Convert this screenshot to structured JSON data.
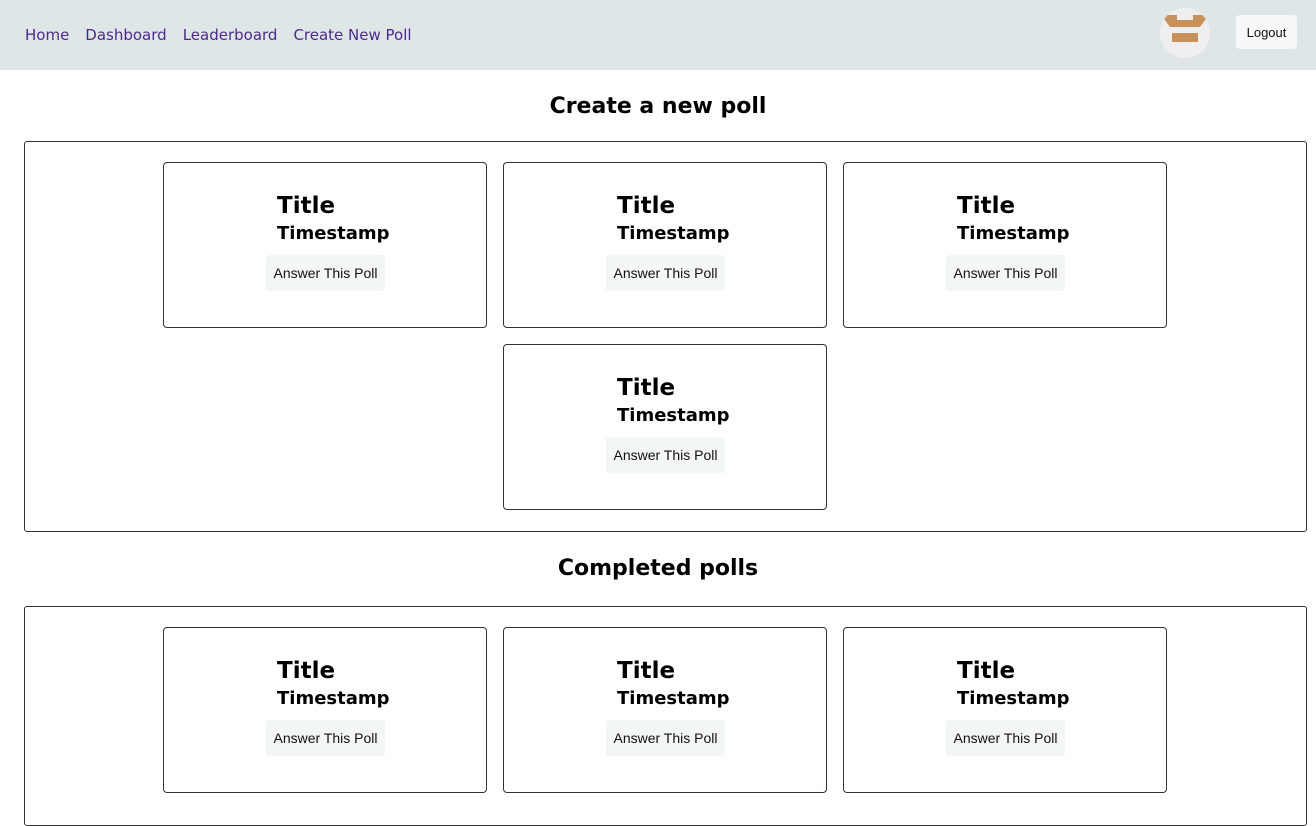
{
  "nav": {
    "links": [
      "Home",
      "Dashboard",
      "Leaderboard",
      "Create New Poll"
    ],
    "logout_label": "Logout"
  },
  "new_polls": {
    "heading": "Create a new poll",
    "cards": [
      {
        "title": "Title",
        "timestamp": "Timestamp",
        "button": "Answer This Poll"
      },
      {
        "title": "Title",
        "timestamp": "Timestamp",
        "button": "Answer This Poll"
      },
      {
        "title": "Title",
        "timestamp": "Timestamp",
        "button": "Answer This Poll"
      },
      {
        "title": "Title",
        "timestamp": "Timestamp",
        "button": "Answer This Poll"
      }
    ]
  },
  "completed_polls": {
    "heading": "Completed polls",
    "cards": [
      {
        "title": "Title",
        "timestamp": "Timestamp",
        "button": "Answer This Poll"
      },
      {
        "title": "Title",
        "timestamp": "Timestamp",
        "button": "Answer This Poll"
      },
      {
        "title": "Title",
        "timestamp": "Timestamp",
        "button": "Answer This Poll"
      }
    ]
  },
  "colors": {
    "navbar_bg": "#dee6e8",
    "nav_link": "#4d2a8a",
    "avatar_accent": "#c8915a"
  },
  "icons": {
    "avatar": "user-avatar-icon"
  }
}
